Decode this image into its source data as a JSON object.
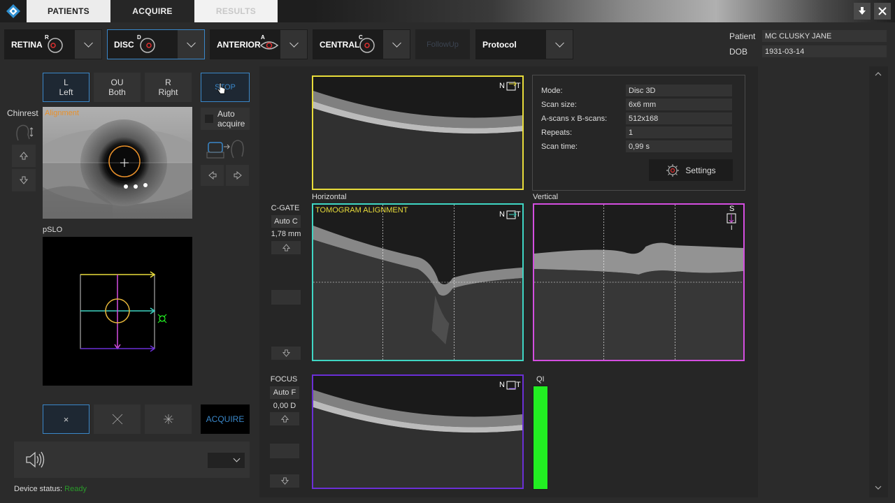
{
  "tabs": {
    "patients": "PATIENTS",
    "acquire": "ACQUIRE",
    "results": "RESULTS"
  },
  "modes": {
    "retina": {
      "label": "RETINA",
      "sup": "R"
    },
    "disc": {
      "label": "DISC",
      "sup": "D"
    },
    "anterior": {
      "label": "ANTERIOR",
      "sup": "A"
    },
    "central": {
      "label": "CENTRAL",
      "sup": "C"
    },
    "followup": "FollowUp",
    "protocol": "Protocol"
  },
  "patient": {
    "patient_label": "Patient",
    "patient_value": "MC CLUSKY JANE",
    "dob_label": "DOB",
    "dob_value": "1931-03-14"
  },
  "eye": {
    "left_top": "L",
    "left_bottom": "Left",
    "both_top": "OU",
    "both_bottom": "Both",
    "right_top": "R",
    "right_bottom": "Right"
  },
  "stop_label": "STOP",
  "auto_acquire": "Auto acquire",
  "chinrest": "Chinrest",
  "alignment": "Alignment",
  "pslo": "pSLO",
  "acquire_label": "ACQUIRE",
  "device_status": {
    "label": "Device status:",
    "value": "Ready"
  },
  "scan": {
    "horizontal": "Horizontal",
    "vertical": "Vertical",
    "tomogram_alignment": "TOMOGRAM ALIGNMENT",
    "qi": "QI",
    "n": "N",
    "t": "T",
    "s": "S",
    "i": "I"
  },
  "cgate": {
    "label": "C-GATE",
    "auto": "Auto C",
    "value": "1,78 mm"
  },
  "focus": {
    "label": "FOCUS",
    "auto": "Auto F",
    "value": "0,00 D"
  },
  "info": {
    "mode_label": "Mode:",
    "mode_value": "Disc 3D",
    "size_label": "Scan size:",
    "size_value": "6x6 mm",
    "ascans_label": "A-scans x B-scans:",
    "ascans_value": "512x168",
    "repeats_label": "Repeats:",
    "repeats_value": "1",
    "time_label": "Scan time:",
    "time_value": "0,99 s",
    "settings": "Settings"
  },
  "colors": {
    "yellow": "#e8dc3a",
    "cyan": "#3fd6c4",
    "magenta": "#d44ee0",
    "purple": "#6b2fd6",
    "green": "#22ee22",
    "accent": "#3a87c9"
  }
}
